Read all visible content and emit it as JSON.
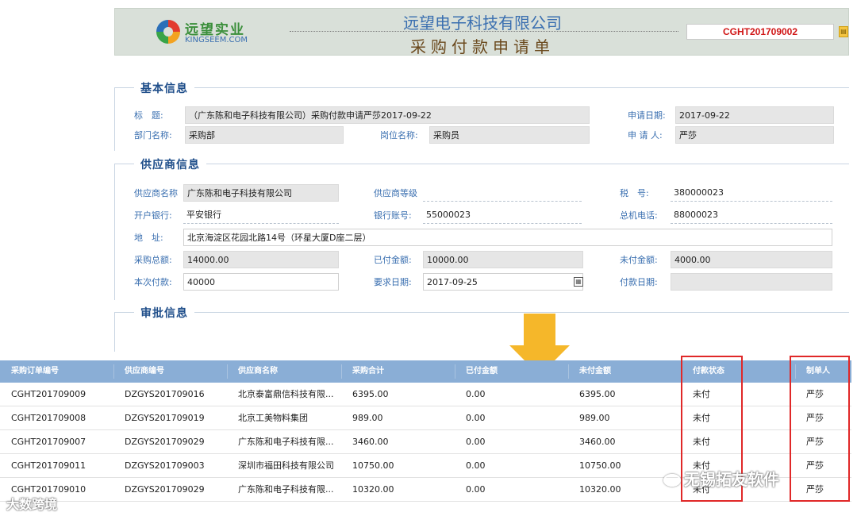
{
  "header": {
    "logo_cn": "远望实业",
    "logo_en": "KINGSEEM.COM",
    "company": "远望电子科技有限公司",
    "form_title": "采购付款申请单",
    "order_no": "CGHT201709002"
  },
  "basic": {
    "title": "基本信息",
    "subject_label": "标　题:",
    "subject_value": "（广东陈和电子科技有限公司）采购付款申请严莎2017-09-22",
    "apply_date_label": "申请日期:",
    "apply_date_value": "2017-09-22",
    "dept_label": "部门名称:",
    "dept_value": "采购部",
    "post_label": "岗位名称:",
    "post_value": "采购员",
    "applicant_label": "申 请 人:",
    "applicant_value": "严莎"
  },
  "supplier": {
    "title": "供应商信息",
    "name_label": "供应商名称",
    "name_value": "广东陈和电子科技有限公司",
    "grade_label": "供应商等级",
    "grade_value": "",
    "tax_label": "税　号:",
    "tax_value": "380000023",
    "bank_label": "开户银行:",
    "bank_value": "平安银行",
    "account_label": "银行账号:",
    "account_value": "55000023",
    "phone_label": "总机电话:",
    "phone_value": "88000023",
    "address_label": "地　址:",
    "address_value": "北京海淀区花园北路14号（环星大厦D座二层）",
    "total_label": "采购总额:",
    "total_value": "14000.00",
    "paid_label": "已付金额:",
    "paid_value": "10000.00",
    "unpaid_label": "未付金额:",
    "unpaid_value": "4000.00",
    "current_label": "本次付款:",
    "current_value": "40000",
    "req_date_label": "要求日期:",
    "req_date_value": "2017-09-25",
    "pay_date_label": "付款日期:",
    "pay_date_value": ""
  },
  "approval": {
    "title": "审批信息"
  },
  "table": {
    "headers": [
      "采购订单编号",
      "供应商编号",
      "供应商名称",
      "采购合计",
      "已付金额",
      "未付金额",
      "付款状态",
      "制单人"
    ],
    "rows": [
      [
        "CGHT201709009",
        "DZGYS201709016",
        "北京泰富鼎信科技有限...",
        "6395.00",
        "0.00",
        "6395.00",
        "未付",
        "严莎"
      ],
      [
        "CGHT201709008",
        "DZGYS201709019",
        "北京工美物料集团",
        "989.00",
        "0.00",
        "989.00",
        "未付",
        "严莎"
      ],
      [
        "CGHT201709007",
        "DZGYS201709029",
        "广东陈和电子科技有限...",
        "3460.00",
        "0.00",
        "3460.00",
        "未付",
        "严莎"
      ],
      [
        "CGHT201709011",
        "DZGYS201709003",
        "深圳市福田科技有限公司",
        "10750.00",
        "0.00",
        "10750.00",
        "未付",
        "严莎"
      ],
      [
        "CGHT201709010",
        "DZGYS201709029",
        "广东陈和电子科技有限...",
        "10320.00",
        "0.00",
        "10320.00",
        "未付",
        "严莎"
      ]
    ]
  },
  "watermarks": {
    "left": "大数跨境",
    "right": "无锡拓友软件"
  },
  "colors": {
    "header_bg": "#d9e0d9",
    "label_blue": "#3a6fb0",
    "section_title": "#1f4e8a",
    "table_header": "#8aaed6",
    "highlight_red": "#e02828",
    "arrow_yellow": "#f5b72a",
    "order_red": "#d01515"
  }
}
